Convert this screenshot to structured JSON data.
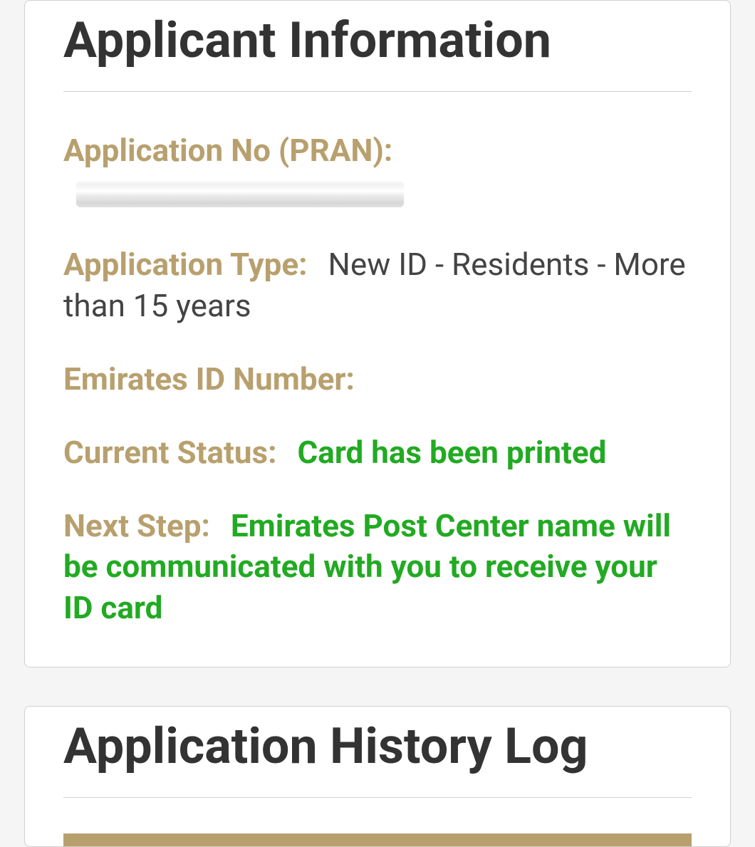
{
  "applicant_info": {
    "title": "Applicant Information",
    "pran_label": "Application No (PRAN):",
    "pran_value": "",
    "app_type_label": "Application Type:",
    "app_type_value": "New ID - Residents - More than 15 years",
    "eid_label": "Emirates ID Number:",
    "eid_value": "",
    "status_label": "Current Status:",
    "status_value": "Card has been printed",
    "next_step_label": "Next Step:",
    "next_step_value": "Emirates Post Center name will be communicated with you to receive your ID card"
  },
  "history_log": {
    "title": "Application History Log"
  }
}
